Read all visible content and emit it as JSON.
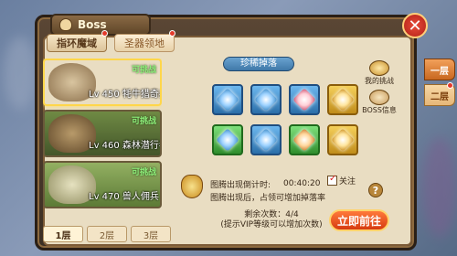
{
  "title": "Boss",
  "tabs": [
    {
      "label": "指环魔域"
    },
    {
      "label": "圣器领地"
    }
  ],
  "bosses": [
    {
      "name": "Lv 450 牦牛猎奇兵",
      "status": "可挑战",
      "color": "#c2a878"
    },
    {
      "name": "Lv 460 森林潜行者",
      "status": "可挑战",
      "color": "#8f9a63"
    },
    {
      "name": "Lv 470 兽人佣兵",
      "status": "可挑战",
      "color": "#a3b06a"
    }
  ],
  "floors": [
    "1层",
    "2层",
    "3层"
  ],
  "treasure_label": "珍稀掉落",
  "items": [
    {
      "type": "blue"
    },
    {
      "type": "blue"
    },
    {
      "type": "blue"
    },
    {
      "type": "gold"
    },
    {
      "type": "green"
    },
    {
      "type": "blue"
    },
    {
      "type": "green"
    },
    {
      "type": "gold"
    }
  ],
  "side_buttons": [
    {
      "label": "我的挑战"
    },
    {
      "label": "BOSS信息"
    }
  ],
  "right_tabs": [
    "一层",
    "二层"
  ],
  "timer": {
    "countdown_label": "图腾出现倒计时:",
    "countdown_value": "00:40:20",
    "follow_label": "关注",
    "note": "图腾出现后，占领可增加掉落率"
  },
  "remain": {
    "line1": "剩余次数：4/4",
    "line2": "(提示VIP等级可以增加次数)"
  },
  "go_button": "立即前往"
}
